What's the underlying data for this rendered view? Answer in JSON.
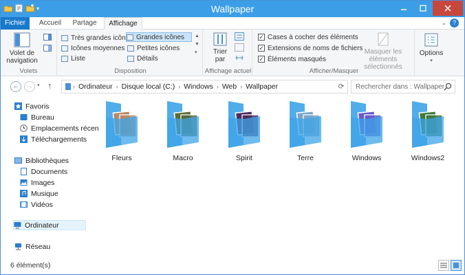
{
  "window": {
    "title": "Wallpaper"
  },
  "tabs": [
    {
      "label": "Fichier"
    },
    {
      "label": "Accueil"
    },
    {
      "label": "Partage"
    },
    {
      "label": "Affichage"
    }
  ],
  "ribbon": {
    "volets": {
      "nav_label": "Volet de navigation",
      "group": "Volets"
    },
    "disposition": {
      "group": "Disposition",
      "items": [
        "Très grandes icônes",
        "Grandes icônes",
        "Icônes moyennes",
        "Petites icônes",
        "Liste",
        "Détails"
      ],
      "selected": "Grandes icônes"
    },
    "affichage_actuel": {
      "sort_label": "Trier par",
      "group": "Affichage actuel"
    },
    "afficher_masquer": {
      "group": "Afficher/Masquer",
      "checks": [
        "Cases à cocher des éléments",
        "Extensions de noms de fichiers",
        "Éléments masqués"
      ],
      "hide_label": "Masquer les éléments sélectionnés"
    },
    "options": {
      "label": "Options"
    }
  },
  "address": {
    "crumbs": [
      "Ordinateur",
      "Disque local (C:)",
      "Windows",
      "Web",
      "Wallpaper"
    ],
    "search_placeholder": "Rechercher dans : Wallpaper"
  },
  "nav": {
    "favoris": "Favoris",
    "fav_items": [
      "Bureau",
      "Emplacements récen",
      "Téléchargements"
    ],
    "bibliotheques": "Bibliothèques",
    "lib_items": [
      "Documents",
      "Images",
      "Musique",
      "Vidéos"
    ],
    "ordinateur": "Ordinateur",
    "reseau": "Réseau"
  },
  "folders": [
    {
      "name": "Fleurs",
      "thumb": "#b58a6a"
    },
    {
      "name": "Macro",
      "thumb": "#5b6b3a"
    },
    {
      "name": "Spirit",
      "thumb": "#4c2c5e"
    },
    {
      "name": "Terre",
      "thumb": "#7aa7c7"
    },
    {
      "name": "Windows",
      "thumb": "#6a5acd"
    },
    {
      "name": "Windows2",
      "thumb": "#3f7a3a"
    }
  ],
  "status": {
    "count": "6 élément(s)"
  },
  "colors": {
    "accent": "#1979ca",
    "titlebar": "#3c9ee6",
    "folder": "#3ea4e8"
  }
}
